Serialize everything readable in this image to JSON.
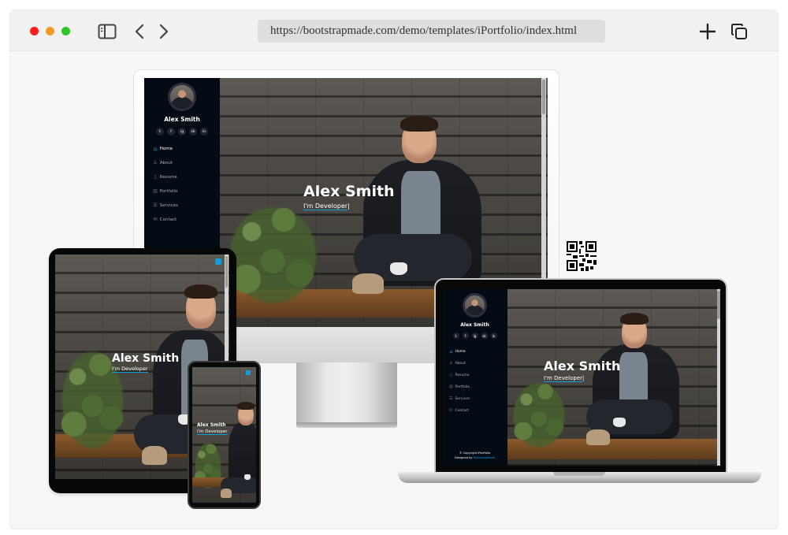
{
  "browser": {
    "url": "https://bootstrapmade.com/demo/templates/iPortfolio/index.html",
    "icons": {
      "sidebar_toggle": "sidebar-toggle-icon",
      "back": "chevron-left-icon",
      "forward": "chevron-right-icon",
      "new_tab": "plus-icon",
      "tabs": "tabs-copy-icon"
    },
    "window_controls_colors": [
      "#fe1e1e",
      "#f09a27",
      "#2dc52a"
    ]
  },
  "site": {
    "name": "Alex Smith",
    "hero_title": "Alex Smith",
    "hero_subtitle": "I'm Developer",
    "cursor": "|",
    "social_icons": [
      "t",
      "f",
      "ig",
      "sk",
      "in"
    ],
    "nav": [
      {
        "label": "Home",
        "icon": "house-icon",
        "active": true
      },
      {
        "label": "About",
        "icon": "user-icon",
        "active": false
      },
      {
        "label": "Resume",
        "icon": "file-icon",
        "active": false
      },
      {
        "label": "Portfolio",
        "icon": "book-icon",
        "active": false
      },
      {
        "label": "Services",
        "icon": "server-icon",
        "active": false
      },
      {
        "label": "Contact",
        "icon": "envelope-icon",
        "active": false
      }
    ],
    "footer_copyright": "© Copyright iPortfolio",
    "footer_designed_prefix": "Designed by ",
    "footer_designed_brand": "BootstrapMade",
    "accent_color": "#149ddd",
    "sidebar_color": "#040b14"
  }
}
